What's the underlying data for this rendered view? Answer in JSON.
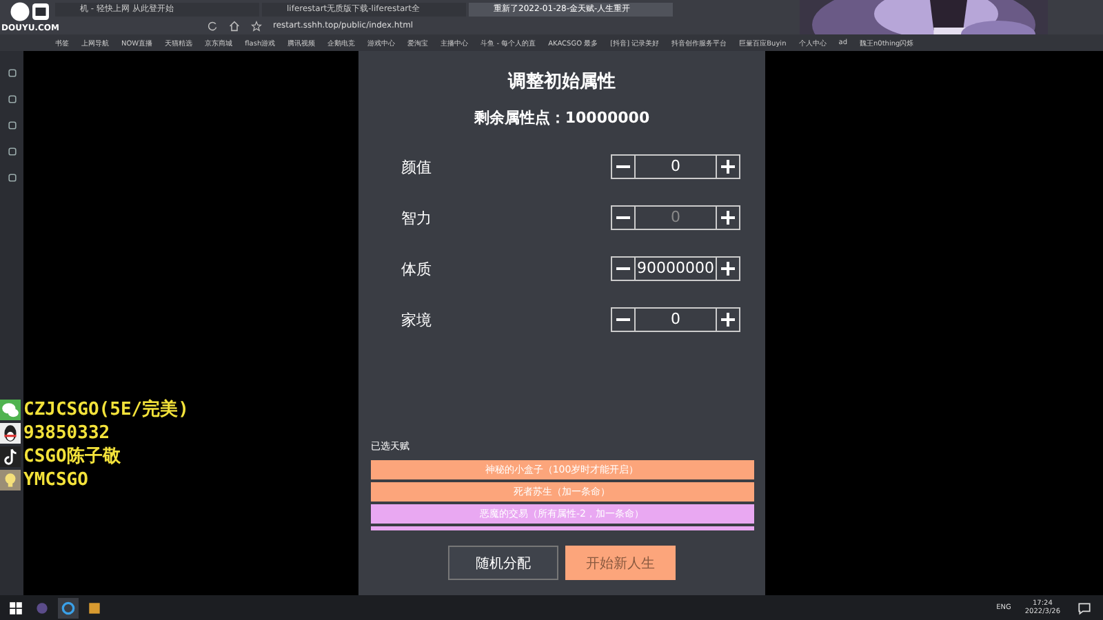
{
  "browser": {
    "tabs": [
      {
        "title": "机 - 轻快上网 从此登开始",
        "selected": false
      },
      {
        "title": "liferestart无质版下载-liferestart全",
        "selected": false
      },
      {
        "title": "重新了2022-01-28-金天赋-人生重开",
        "selected": true
      }
    ],
    "address": "restart.sshh.top/public/index.html",
    "bookmarks": [
      "书签",
      "上网导航",
      "NOW直播",
      "天猫精选",
      "京东商城",
      "flash游戏",
      "腾讯视频",
      "企鹅电竞",
      "游戏中心",
      "爱淘宝",
      "主播中心",
      "斗鱼 - 每个人的直",
      "AKACSGO 最多",
      "[抖音] 记录美好",
      "抖音创作服务平台",
      "巨量百应Buyin",
      "个人中心",
      "ad",
      "魏王n0thing闪烁"
    ]
  },
  "overlay": {
    "logo": "DOUYU.COM",
    "contacts": [
      {
        "kind": "wechat",
        "text": "CZJCSGO(5E/完美)"
      },
      {
        "kind": "qq",
        "text": "93850332"
      },
      {
        "kind": "tiktok",
        "text": "CSGO陈子敬"
      },
      {
        "kind": "bulb",
        "text": "YMCSGO"
      }
    ]
  },
  "panel": {
    "title": "调整初始属性",
    "remaining": "剩余属性点：10000000",
    "attributes": [
      {
        "label": "颜值",
        "value": "0",
        "focused": false
      },
      {
        "label": "智力",
        "value": "0",
        "focused": true
      },
      {
        "label": "体质",
        "value": "90000000",
        "focused": false
      },
      {
        "label": "家境",
        "value": "0",
        "focused": false
      }
    ],
    "talents_label": "已选天赋",
    "talents": [
      {
        "text": "神秘的小盒子（100岁时才能开启）",
        "color": "#fca57b"
      },
      {
        "text": "死者苏生（加一条命）",
        "color": "#fca57b"
      },
      {
        "text": "恶魔的交易（所有属性-2，加一条命）",
        "color": "#e9a8f2"
      },
      {
        "color": "#e9a8f2"
      }
    ],
    "buttons": [
      {
        "label": "随机分配",
        "kind": "secondary"
      },
      {
        "label": "开始新人生",
        "kind": "primary"
      }
    ]
  },
  "taskbar": {
    "language": "ENG",
    "time": "17:24",
    "date": "2022/3/26"
  }
}
